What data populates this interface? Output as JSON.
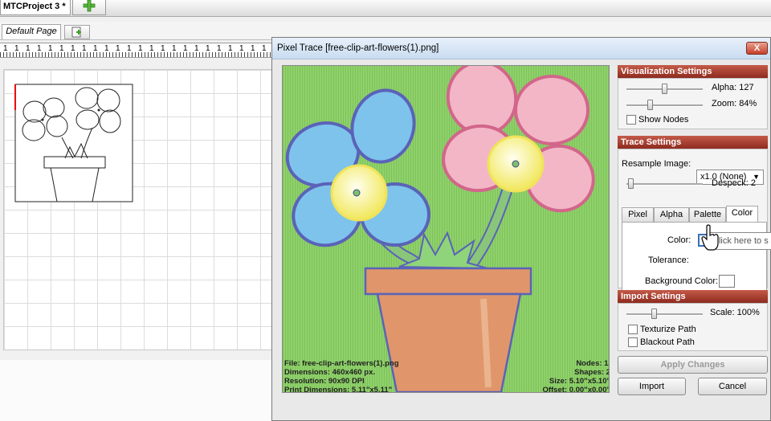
{
  "app": {
    "project_tab": "MTCProject 3 *",
    "page_tab": "Default Page"
  },
  "ruler": {
    "labels": [
      "1",
      "1",
      "1",
      "1",
      "1",
      "1",
      "1",
      "1",
      "1",
      "1",
      "1",
      "1",
      "1",
      "1",
      "1",
      "1",
      "1",
      "1",
      "1",
      "1",
      "1",
      "1",
      "1",
      "1"
    ]
  },
  "dialog": {
    "title": "Pixel Trace [free-clip-art-flowers(1).png]",
    "close_label": "X",
    "info_left": [
      "File: free-clip-art-flowers(1).png",
      "Dimensions: 460x460 px.",
      "Resolution: 90x90 DPI",
      "Print Dimensions: 5.11\"x5.11\""
    ],
    "info_right": [
      "Nodes: 128",
      "Shapes: 2",
      "Size: 5.10\"x5.10\"",
      "Offset: 0.00\"x0.00\""
    ]
  },
  "visualization": {
    "header": "Visualization Settings",
    "alpha_label": "Alpha: 127",
    "alpha_level": 0.5,
    "zoom_label": "Zoom: 84%",
    "zoom_level": 0.3,
    "show_nodes_label": "Show Nodes",
    "show_nodes_checked": false
  },
  "trace": {
    "header": "Trace Settings",
    "resample_label": "Resample Image:",
    "resample_value": "x1.0 (None)",
    "despeck_label": "Despeck: 2",
    "despeck_level": 0.02,
    "tabs": [
      "Pixel",
      "Alpha",
      "Palette",
      "Color"
    ],
    "active_tab": "Color",
    "color_label": "Color:",
    "tolerance_label": "Tolerance:",
    "background_color_label": "Background Color:",
    "tooltip": "Click here to s"
  },
  "import": {
    "header": "Import Settings",
    "scale_label": "Scale: 100%",
    "scale_level": 0.35,
    "texturize_label": "Texturize Path",
    "blackout_label": "Blackout Path"
  },
  "buttons": {
    "apply": "Apply Changes",
    "import": "Import",
    "cancel": "Cancel"
  },
  "colors": {
    "preview_background": "#8fd16a",
    "petal_blue": "#7ec3ec",
    "petal_pink": "#f2b6c7",
    "flower_center": "#f6ef7c",
    "pot": "#e0966a",
    "stem": "#7fbf6a",
    "outline": "#5a63b8",
    "panel_header": "#a53a2c"
  }
}
